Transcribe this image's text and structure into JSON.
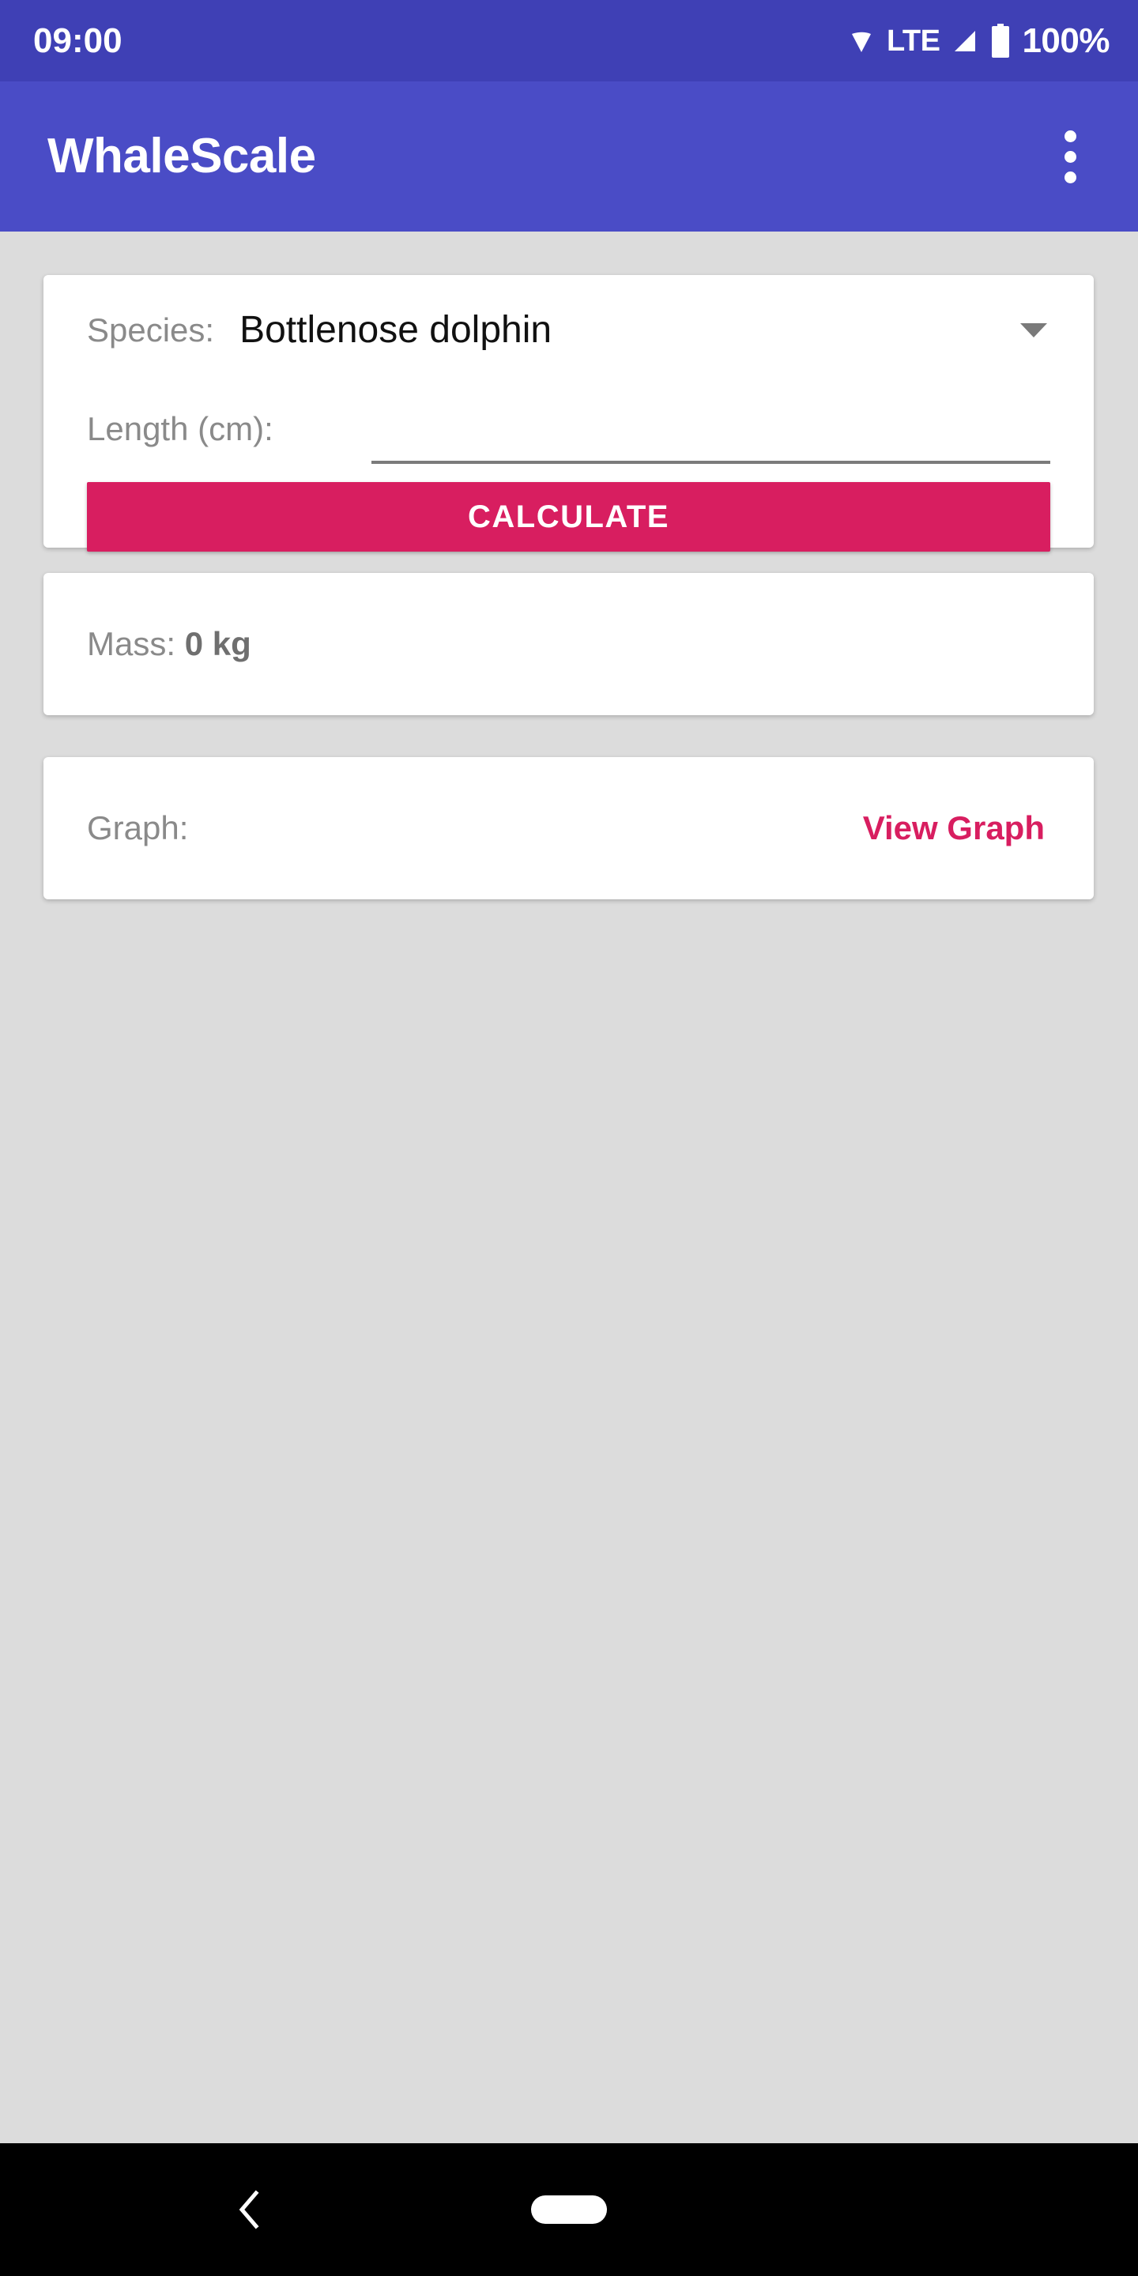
{
  "status_bar": {
    "time": "09:00",
    "network_label": "LTE",
    "battery_percent": "100%",
    "icons": {
      "wifi": "wifi-icon",
      "signal": "signal-icon",
      "battery": "battery-icon"
    },
    "background_color": "#3F40B5"
  },
  "app_bar": {
    "title": "WhaleScale",
    "overflow_icon": "overflow-menu-icon",
    "background_color": "#4A4CC6"
  },
  "input_card": {
    "species_label": "Species:",
    "species_value": "Bottlenose dolphin",
    "species_dropdown_icon": "chevron-down-icon",
    "length_label": "Length (cm):",
    "length_value": "",
    "length_placeholder": "",
    "calculate_label": "CALCULATE",
    "calculate_color": "#D81E60"
  },
  "mass_card": {
    "label": "Mass:",
    "value": "0 kg"
  },
  "graph_card": {
    "label": "Graph:",
    "link_label": "View Graph",
    "link_color": "#D81E60"
  },
  "nav_bar": {
    "back_icon": "back-chevron-icon",
    "home_icon": "home-pill-icon",
    "background_color": "#000000"
  }
}
